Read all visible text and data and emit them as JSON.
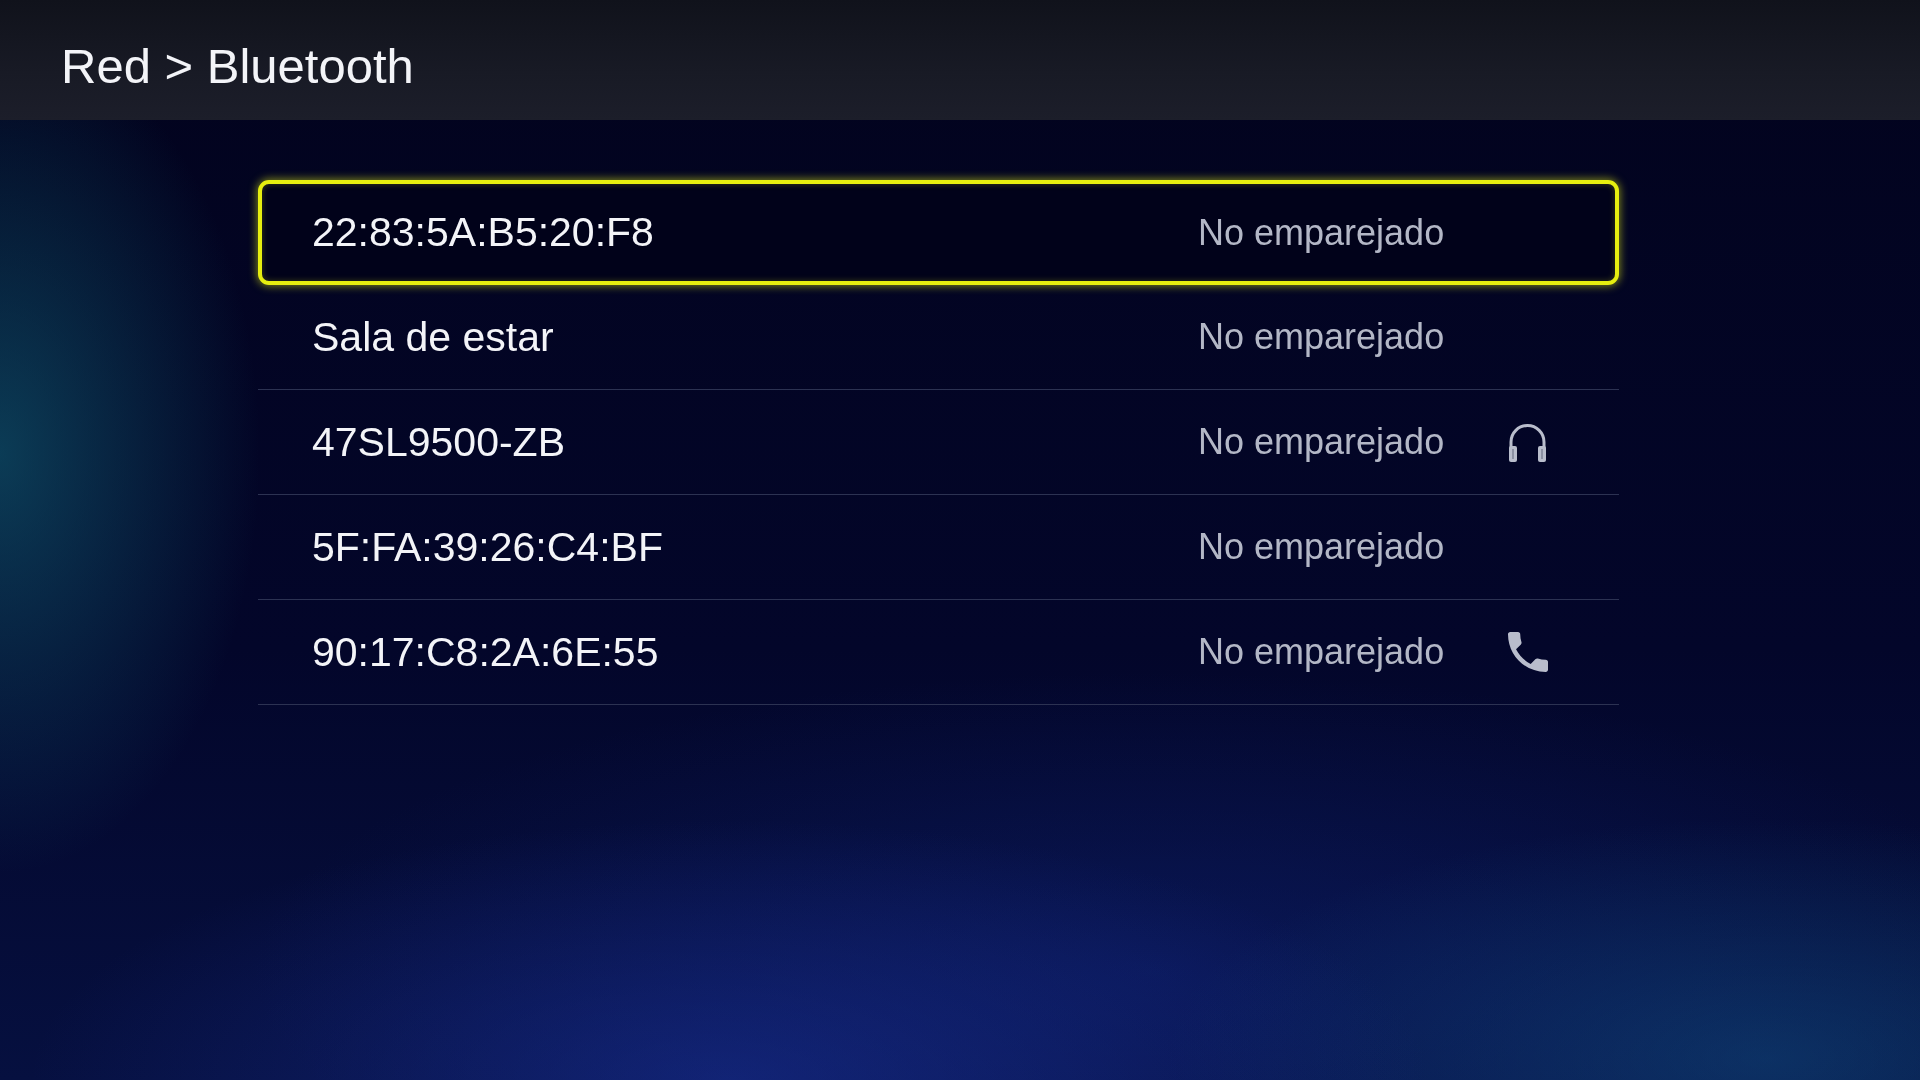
{
  "header": {
    "title": "Red > Bluetooth"
  },
  "devices": [
    {
      "name": "22:83:5A:B5:20:F8",
      "status": "No emparejado",
      "kind": "generic",
      "selected": true
    },
    {
      "name": "Sala de estar",
      "status": "No emparejado",
      "kind": "generic",
      "selected": false
    },
    {
      "name": "47SL9500-ZB",
      "status": "No emparejado",
      "kind": "headphones",
      "selected": false
    },
    {
      "name": "5F:FA:39:26:C4:BF",
      "status": "No emparejado",
      "kind": "generic",
      "selected": false
    },
    {
      "name": "90:17:C8:2A:6E:55",
      "status": "No emparejado",
      "kind": "phone",
      "selected": false
    }
  ]
}
